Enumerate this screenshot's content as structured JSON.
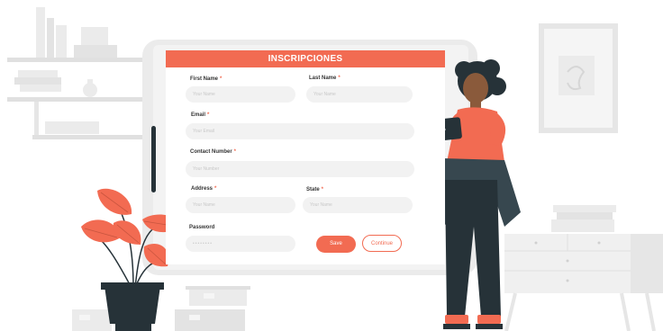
{
  "form": {
    "title": "INSCRIPCIONES",
    "required_marker": "*",
    "first_name": {
      "label": "First Name",
      "placeholder": "Your Name"
    },
    "last_name": {
      "label": "Last Name",
      "placeholder": "Your Name"
    },
    "email": {
      "label": "Email",
      "placeholder": "Your Email"
    },
    "contact_number": {
      "label": "Contact Number",
      "placeholder": "Your Number"
    },
    "address": {
      "label": "Address",
      "placeholder": "Your Name"
    },
    "state": {
      "label": "State",
      "placeholder": "Your Name"
    },
    "password": {
      "label": "Password",
      "masked_value": "••••••••"
    },
    "save_label": "Save",
    "continue_label": "Continue"
  },
  "colors": {
    "accent": "#F26B52",
    "device_frame": "#e6e6e6",
    "figure_dark": "#263238",
    "skin": "#8a5a3b",
    "background_grey": "#ebebeb"
  }
}
